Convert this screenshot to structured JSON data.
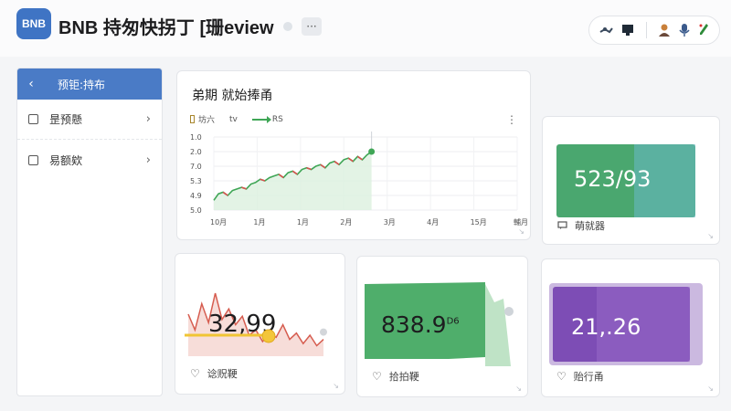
{
  "header": {
    "logo_text": "BNB",
    "title": "BNB 持匆快拐丁 [珊eview",
    "more_label": "···"
  },
  "sidebar": {
    "title": "预钜:持布",
    "items": [
      {
        "label": "昰预懸"
      },
      {
        "label": "易额欸"
      }
    ]
  },
  "main_chart": {
    "title": "弟期 就始捧甬",
    "legend": [
      {
        "label": "坊六"
      },
      {
        "label": "tv"
      },
      {
        "label": "RS"
      }
    ],
    "chart_data": {
      "type": "line",
      "y_ticks": [
        "1.0",
        "2.0",
        "7.0",
        "5.3",
        "4.9",
        "5.0"
      ],
      "x_ticks": [
        "10月",
        "1月",
        "1月",
        "2月",
        "3月",
        "4月",
        "15月",
        "輔月"
      ],
      "series": [
        {
          "name": "RS",
          "values": [
            4.6,
            5.0,
            5.1,
            4.9,
            5.2,
            5.3,
            5.4,
            5.3,
            5.6,
            5.7,
            5.9,
            5.8,
            6.0,
            6.1,
            6.2,
            6.0,
            6.3,
            6.4,
            6.2,
            6.5,
            6.6,
            6.5,
            6.7,
            6.8,
            6.6,
            6.9,
            7.0,
            6.8,
            7.1,
            7.2,
            7.0,
            7.3,
            7.1,
            7.4,
            7.6
          ]
        }
      ],
      "colors": {
        "line": "#3fa656",
        "dip": "#d9534f",
        "fill": "#dcf0de"
      }
    }
  },
  "cards": {
    "green_top": {
      "value": "523/93",
      "footer": "萌就器"
    },
    "red": {
      "value": "32,99",
      "footer": "谂贶鞕",
      "slider_fraction": 0.6
    },
    "green_mid": {
      "value": "838.9",
      "value_sup": "D6",
      "footer": "拾拍鞕"
    },
    "purple": {
      "value": "21,.26",
      "footer": "贻行甬"
    }
  }
}
